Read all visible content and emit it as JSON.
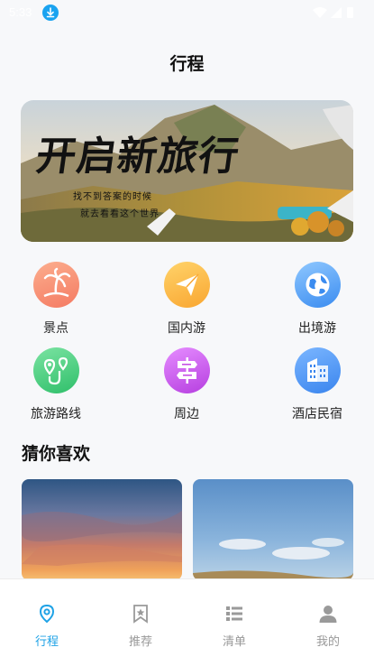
{
  "status_bar": {
    "time": "5:33",
    "download_icon": "download-icon"
  },
  "header": {
    "title": "行程"
  },
  "banner": {
    "title": "开启新旅行",
    "subtitle_line1": "找不到答案的时候",
    "subtitle_line2": "就去看看这个世界"
  },
  "categories": [
    {
      "label": "景点",
      "icon": "palm-island-icon",
      "color": "#f7876a"
    },
    {
      "label": "国内游",
      "icon": "paper-plane-icon",
      "color": "#fbb53a"
    },
    {
      "label": "出境游",
      "icon": "globe-icon",
      "color": "#3d9af0"
    },
    {
      "label": "旅游路线",
      "icon": "route-pin-icon",
      "color": "#3ccf7a"
    },
    {
      "label": "周边",
      "icon": "signpost-icon",
      "color": "#c64fe6"
    },
    {
      "label": "酒店民宿",
      "icon": "hotel-building-icon",
      "color": "#3b8df2"
    }
  ],
  "recommend": {
    "title": "猜你喜欢"
  },
  "tabbar": {
    "items": [
      {
        "label": "行程",
        "icon": "location-pin-icon",
        "active": true
      },
      {
        "label": "推荐",
        "icon": "bookmark-star-icon",
        "active": false
      },
      {
        "label": "清单",
        "icon": "list-icon",
        "active": false
      },
      {
        "label": "我的",
        "icon": "user-icon",
        "active": false
      }
    ],
    "active_color": "#1ea2e6",
    "inactive_color": "#999999"
  }
}
